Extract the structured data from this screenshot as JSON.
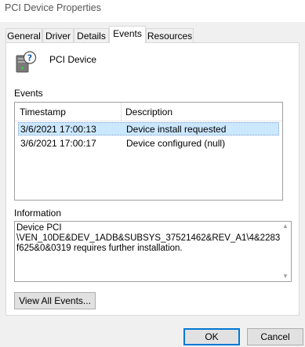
{
  "window": {
    "title": "PCI Device Properties"
  },
  "tabs": [
    {
      "label": "General",
      "active": false
    },
    {
      "label": "Driver",
      "active": false
    },
    {
      "label": "Details",
      "active": false
    },
    {
      "label": "Events",
      "active": true
    },
    {
      "label": "Resources",
      "active": false
    }
  ],
  "device": {
    "name": "PCI Device",
    "icon": "unknown-device-icon"
  },
  "events": {
    "label": "Events",
    "columns": [
      "Timestamp",
      "Description"
    ],
    "rows": [
      {
        "timestamp": "3/6/2021 17:00:13",
        "description": "Device install requested",
        "selected": true
      },
      {
        "timestamp": "3/6/2021 17:00:17",
        "description": "Device configured (null)",
        "selected": false
      }
    ]
  },
  "information": {
    "label": "Information",
    "text": "Device PCI\n\\VEN_10DE&DEV_1ADB&SUBSYS_37521462&REV_A1\\4&2283f625&0&0319 requires further installation."
  },
  "buttons": {
    "view_all_events": "View All Events...",
    "ok": "OK",
    "cancel": "Cancel"
  },
  "colors": {
    "selection": "#cce8ff",
    "primary_border": "#0078d7"
  }
}
